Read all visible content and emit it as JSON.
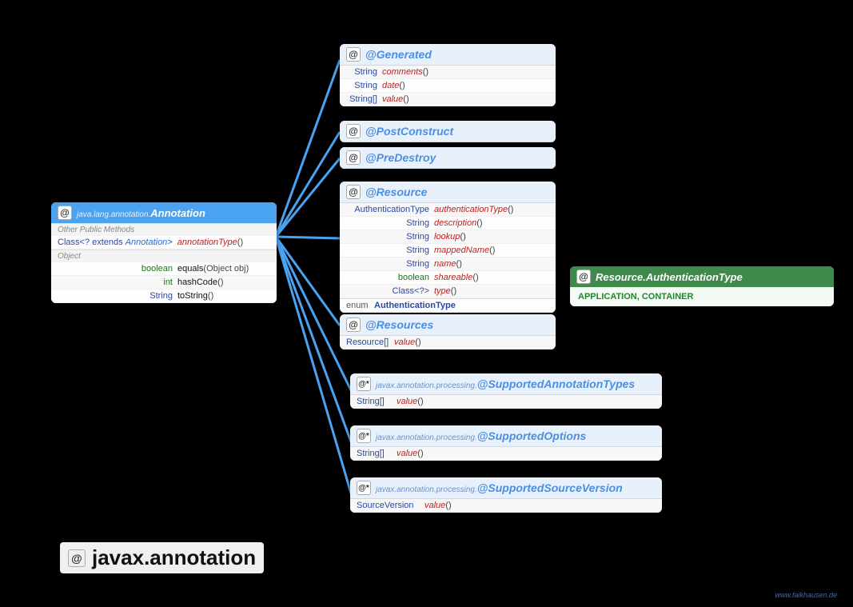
{
  "packageTitle": "javax.annotation",
  "footer": "www.falkhausen.de",
  "interfaceBox": {
    "pkg": "java.lang.annotation.",
    "name": "Annotation",
    "sectionOther": "Other Public Methods",
    "row_annType_ret": "Class<? extends Annotation>",
    "row_annType_name": "annotationType",
    "sectionObject": "Object",
    "row_equals_ret": "boolean",
    "row_equals_name": "equals",
    "row_equals_args": "(Object obj)",
    "row_hash_ret": "int",
    "row_hash_name": "hashCode",
    "row_toStr_ret": "String",
    "row_toStr_name": "toString"
  },
  "annGenerated": {
    "name": "@Generated",
    "r1_ret": "String",
    "r1_name": "comments",
    "r2_ret": "String",
    "r2_name": "date",
    "r3_ret": "String[]",
    "r3_name": "value"
  },
  "annPostConstruct": {
    "name": "@PostConstruct"
  },
  "annPreDestroy": {
    "name": "@PreDestroy"
  },
  "annResource": {
    "name": "@Resource",
    "r1_ret": "AuthenticationType",
    "r1_name": "authenticationType",
    "r2_ret": "String",
    "r2_name": "description",
    "r3_ret": "String",
    "r3_name": "lookup",
    "r4_ret": "String",
    "r4_name": "mappedName",
    "r5_ret": "String",
    "r5_name": "name",
    "r6_ret": "boolean",
    "r6_name": "shareable",
    "r7_ret": "Class<?>",
    "r7_name": "type",
    "enum_ret": "enum",
    "enum_name": "AuthenticationType"
  },
  "annResources": {
    "name": "@Resources",
    "r1_ret": "Resource[]",
    "r1_name": "value"
  },
  "enumBox": {
    "name": "Resource.AuthenticationType",
    "values": "APPLICATION, CONTAINER"
  },
  "annSAT": {
    "pkg": "javax.annotation.processing.",
    "name": "@SupportedAnnotationTypes",
    "r1_ret": "String[]",
    "r1_name": "value",
    "badge": "@*"
  },
  "annSO": {
    "pkg": "javax.annotation.processing.",
    "name": "@SupportedOptions",
    "r1_ret": "String[]",
    "r1_name": "value",
    "badge": "@*"
  },
  "annSSV": {
    "pkg": "javax.annotation.processing.",
    "name": "@SupportedSourceVersion",
    "r1_ret": "SourceVersion",
    "r1_name": "value",
    "badge": "@*"
  },
  "at": "@"
}
